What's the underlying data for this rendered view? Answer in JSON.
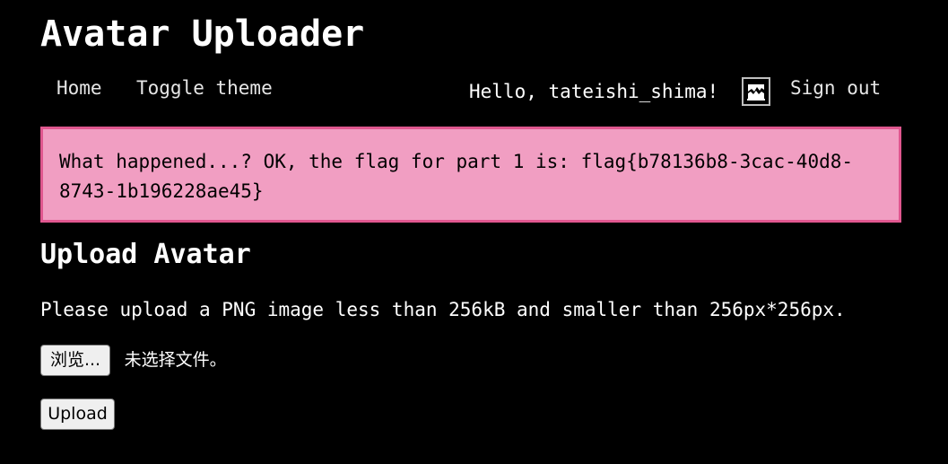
{
  "header": {
    "title": "Avatar Uploader"
  },
  "nav": {
    "home_label": "Home",
    "toggle_theme_label": "Toggle theme",
    "greeting": "Hello, tateishi_shima!",
    "sign_out_label": "Sign out"
  },
  "alert": {
    "message": "What happened...? OK, the flag for part 1 is: flag{b78136b8-3cac-40d8-8743-1b196228ae45}",
    "background_color": "#f19ec2",
    "border_color": "#e0578f"
  },
  "upload": {
    "heading": "Upload Avatar",
    "instructions": "Please upload a PNG image less than 256kB and smaller than 256px*256px.",
    "browse_label": "浏览...",
    "file_status": "未选择文件。",
    "upload_label": "Upload"
  },
  "icons": {
    "avatar": "user-avatar-icon"
  }
}
